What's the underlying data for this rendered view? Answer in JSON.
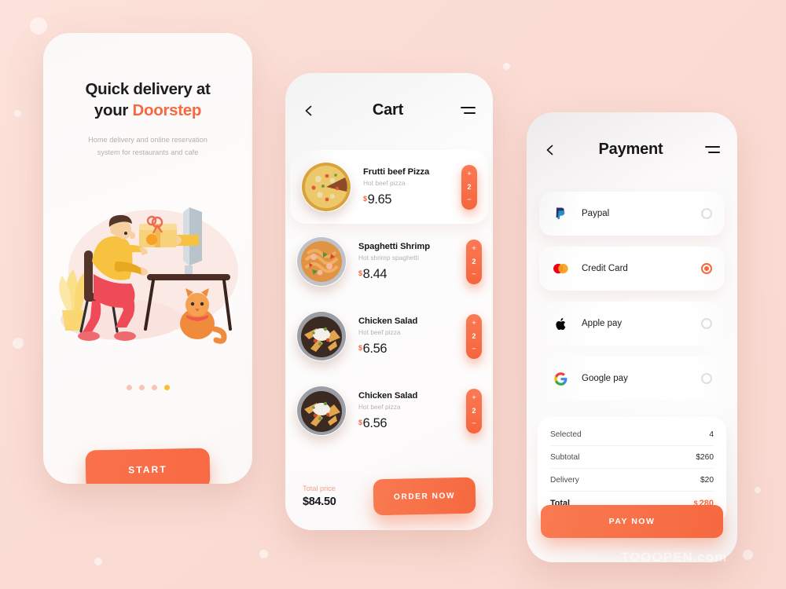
{
  "theme": {
    "accent": "#f8683f",
    "background": "#fadfd7",
    "panel": "#fdfbfa",
    "active_dot": "#f7c02e"
  },
  "watermark": "TOOOPEN.com",
  "onboarding": {
    "title_line1": "Quick delivery at",
    "title_line2_plain": "your ",
    "title_line2_highlight": "Doorstep",
    "subtitle_line1": "Home delivery and online reservation",
    "subtitle_line2": "system for restaurants and cafe",
    "pager": {
      "count": 4,
      "active_index": 3
    },
    "start_label": "START"
  },
  "cart": {
    "title": "Cart",
    "back_icon": "chevron-left-icon",
    "menu_icon": "hamburger-icon",
    "items": [
      {
        "name": "Frutti beef Pizza",
        "desc": "Hot beef pizza",
        "currency": "$",
        "price": "9.65",
        "qty": "2",
        "image": "pizza",
        "highlighted": true
      },
      {
        "name": "Spaghetti Shrimp",
        "desc": "Hot shrimp spaghetti",
        "currency": "$",
        "price": "8.44",
        "qty": "2",
        "image": "spaghetti",
        "highlighted": false
      },
      {
        "name": "Chicken Salad",
        "desc": "Hot beef pizza",
        "currency": "$",
        "price": "6.56",
        "qty": "2",
        "image": "salad",
        "highlighted": false
      },
      {
        "name": "Chicken Salad",
        "desc": "Hot beef pizza",
        "currency": "$",
        "price": "6.56",
        "qty": "2",
        "image": "salad",
        "highlighted": false
      }
    ],
    "stepper": {
      "increment": "+",
      "decrement": "−"
    },
    "total_label": "Total price",
    "total_value": "$84.50",
    "order_label": "ORDER NOW"
  },
  "payment": {
    "title": "Payment",
    "back_icon": "chevron-left-icon",
    "menu_icon": "hamburger-icon",
    "methods": [
      {
        "label": "Paypal",
        "icon": "paypal-icon",
        "selected": false
      },
      {
        "label": "Credit Card",
        "icon": "mastercard-icon",
        "selected": true
      },
      {
        "label": "Apple pay",
        "icon": "apple-icon",
        "selected": false
      },
      {
        "label": "Google pay",
        "icon": "google-icon",
        "selected": false
      }
    ],
    "summary": [
      {
        "key": "Selected",
        "value": "4",
        "total": false
      },
      {
        "key": "Subtotal",
        "value": "$260",
        "total": false
      },
      {
        "key": "Delivery",
        "value": "$20",
        "total": false
      },
      {
        "key": "Total",
        "currency": "$",
        "value": "280",
        "total": true
      }
    ],
    "pay_label": "PAY NOW"
  }
}
